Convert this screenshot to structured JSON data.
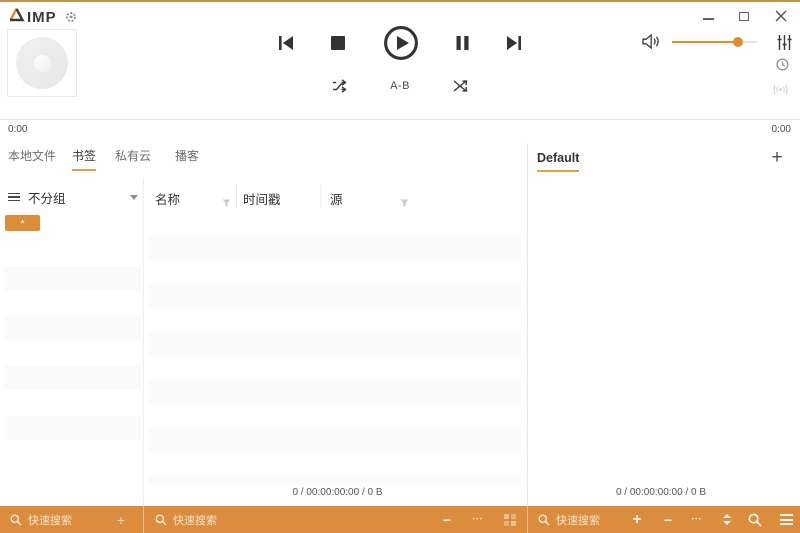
{
  "colors": {
    "accent": "#DD8C3C",
    "accent_underline": "#DFA053",
    "top_border": "#C9914F",
    "bottom_bar": "#DC8C3D"
  },
  "player": {
    "logo_text": "IMP",
    "ab_label": "A-B",
    "elapsed": "0:00",
    "duration": "0:00",
    "volume_percent": 78
  },
  "library": {
    "tabs": [
      {
        "label": "本地文件",
        "active": false
      },
      {
        "label": "书签",
        "active": true
      },
      {
        "label": "私有云",
        "active": false
      },
      {
        "label": "播客",
        "active": false
      }
    ],
    "group_header": {
      "label": "不分组"
    },
    "group_button_glyph": "*",
    "group_placeholder_rows": 4,
    "columns": [
      {
        "label": "名称",
        "filter": true
      },
      {
        "label": "时间戳",
        "filter": false
      },
      {
        "label": "源",
        "filter": true
      }
    ],
    "table_placeholder_rows": 6,
    "status": "0 / 00:00:00:00 / 0 B"
  },
  "playlist": {
    "tab_label": "Default",
    "add_label": "+",
    "status": "0 / 00:00:00:00 / 0 B"
  },
  "bottom_bar": {
    "search_left_placeholder": "快速搜索",
    "search_middle_placeholder": "快速搜索",
    "search_right_placeholder": "快速搜索",
    "glyphs": {
      "add": "+",
      "remove": "−",
      "more": "•••"
    }
  }
}
